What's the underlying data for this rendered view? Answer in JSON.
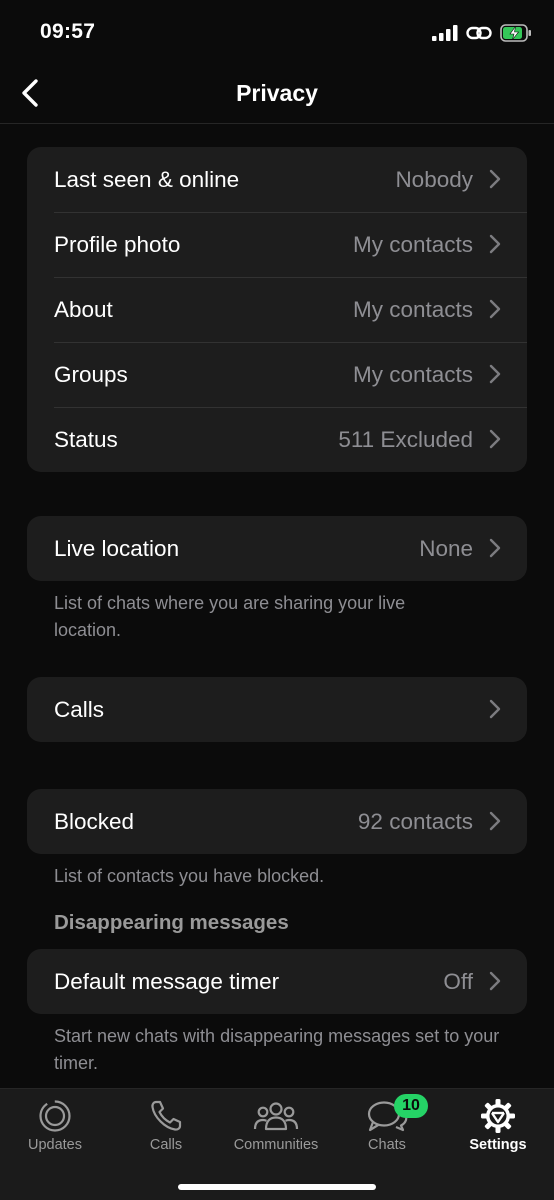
{
  "status_bar": {
    "time": "09:57"
  },
  "nav": {
    "title": "Privacy"
  },
  "privacy_group": {
    "items": [
      {
        "label": "Last seen & online",
        "value": "Nobody"
      },
      {
        "label": "Profile photo",
        "value": "My contacts"
      },
      {
        "label": "About",
        "value": "My contacts"
      },
      {
        "label": "Groups",
        "value": "My contacts"
      },
      {
        "label": "Status",
        "value": "511 Excluded"
      }
    ]
  },
  "live_location": {
    "label": "Live location",
    "value": "None",
    "footnote": "List of chats where you are sharing your live location."
  },
  "calls": {
    "label": "Calls"
  },
  "blocked": {
    "label": "Blocked",
    "value": "92 contacts",
    "footnote": "List of contacts you have blocked."
  },
  "disappearing": {
    "header": "Disappearing messages",
    "label": "Default message timer",
    "value": "Off",
    "footnote": "Start new chats with disappearing messages set to your timer."
  },
  "tab_bar": {
    "tabs": [
      {
        "label": "Updates",
        "icon": "updates-icon"
      },
      {
        "label": "Calls",
        "icon": "phone-icon"
      },
      {
        "label": "Communities",
        "icon": "communities-icon"
      },
      {
        "label": "Chats",
        "icon": "chats-icon",
        "badge": "10"
      },
      {
        "label": "Settings",
        "icon": "settings-gear-icon",
        "active": true
      }
    ]
  },
  "colors": {
    "background": "#0b0b0b",
    "card": "#1d1d1d",
    "secondary_text": "#8e8e93",
    "accent_green": "#25d366",
    "battery_green": "#34c759"
  }
}
